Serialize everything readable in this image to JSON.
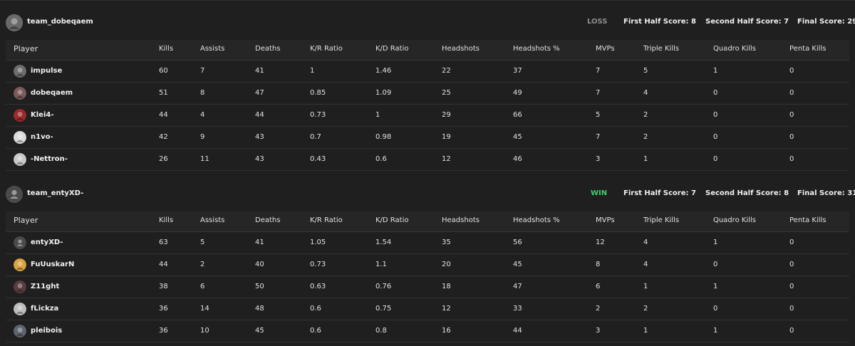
{
  "colors": {
    "loss": "#8d8d8d",
    "win": "#3cd36a"
  },
  "columns": [
    "Player",
    "Kills",
    "Assists",
    "Deaths",
    "K/R Ratio",
    "K/D Ratio",
    "Headshots",
    "Headshots %",
    "MVPs",
    "Triple Kills",
    "Quadro Kills",
    "Penta Kills"
  ],
  "teams": [
    {
      "name": "team_dobeqaem",
      "result": "LOSS",
      "first_half": "First Half Score: 8",
      "second_half": "Second Half Score: 7",
      "final": "Final Score: 29",
      "avatar_icon": "wolf-avatar-icon",
      "players": [
        {
          "name": "impulse",
          "avatar_icon": "player-avatar-icon",
          "avatar_color": "#6d6d70",
          "stats": [
            "60",
            "7",
            "41",
            "1",
            "1.46",
            "22",
            "37",
            "7",
            "5",
            "1",
            "0"
          ]
        },
        {
          "name": "dobeqaem",
          "avatar_icon": "player-avatar-icon",
          "avatar_color": "#7a5a5a",
          "stats": [
            "51",
            "8",
            "47",
            "0.85",
            "1.09",
            "25",
            "49",
            "7",
            "4",
            "0",
            "0"
          ]
        },
        {
          "name": "Klei4-",
          "avatar_icon": "player-avatar-icon",
          "avatar_color": "#9c2a2a",
          "stats": [
            "44",
            "4",
            "44",
            "0.73",
            "1",
            "29",
            "66",
            "5",
            "2",
            "0",
            "0"
          ]
        },
        {
          "name": "n1vo-",
          "avatar_icon": "player-avatar-icon",
          "avatar_color": "#dcdcdc",
          "stats": [
            "42",
            "9",
            "43",
            "0.7",
            "0.98",
            "19",
            "45",
            "7",
            "2",
            "0",
            "0"
          ]
        },
        {
          "name": "-Nettron-",
          "avatar_icon": "player-avatar-icon",
          "avatar_color": "#c9c9c9",
          "stats": [
            "26",
            "11",
            "43",
            "0.43",
            "0.6",
            "12",
            "46",
            "3",
            "1",
            "0",
            "0"
          ]
        }
      ]
    },
    {
      "name": "team_entyXD-",
      "result": "WIN",
      "first_half": "First Half Score: 7",
      "second_half": "Second Half Score: 8",
      "final": "Final Score: 31",
      "avatar_icon": "default-user-avatar-icon",
      "players": [
        {
          "name": "entyXD-",
          "avatar_icon": "default-user-avatar-icon",
          "avatar_color": "#4a4a4a",
          "stats": [
            "63",
            "5",
            "41",
            "1.05",
            "1.54",
            "35",
            "56",
            "12",
            "4",
            "1",
            "0"
          ]
        },
        {
          "name": "FuUuskarN",
          "avatar_icon": "player-avatar-icon",
          "avatar_color": "#d9a441",
          "stats": [
            "44",
            "2",
            "40",
            "0.73",
            "1.1",
            "20",
            "45",
            "8",
            "4",
            "0",
            "0"
          ]
        },
        {
          "name": "Z11ght",
          "avatar_icon": "player-avatar-icon",
          "avatar_color": "#5a3c40",
          "stats": [
            "38",
            "6",
            "50",
            "0.63",
            "0.76",
            "18",
            "47",
            "6",
            "1",
            "1",
            "0"
          ]
        },
        {
          "name": "fLickza",
          "avatar_icon": "player-avatar-icon",
          "avatar_color": "#bdbdbd",
          "stats": [
            "36",
            "14",
            "48",
            "0.6",
            "0.75",
            "12",
            "33",
            "2",
            "2",
            "0",
            "0"
          ]
        },
        {
          "name": "pleibois",
          "avatar_icon": "player-avatar-icon",
          "avatar_color": "#5f6670",
          "stats": [
            "36",
            "10",
            "45",
            "0.6",
            "0.8",
            "16",
            "44",
            "3",
            "1",
            "1",
            "0"
          ]
        }
      ]
    }
  ]
}
